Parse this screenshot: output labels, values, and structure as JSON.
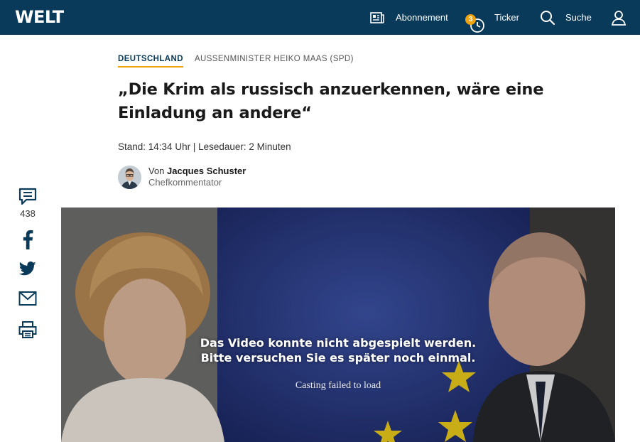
{
  "header": {
    "logo": "WELT",
    "nav": {
      "abonnement": "Abonnement",
      "ticker": "Ticker",
      "ticker_badge": "3",
      "suche": "Suche"
    }
  },
  "article": {
    "section": "DEUTSCHLAND",
    "topic": "AUSSENMINISTER HEIKO MAAS (SPD)",
    "headline_line1": "„Die Krim als russisch anzuerkennen, wäre eine",
    "headline_line2": "Einladung an andere“",
    "dateline": "Stand: 14:34 Uhr | Lesedauer: 2 Minuten",
    "author": {
      "prefix": "Von",
      "name": "Jacques Schuster",
      "role": "Chefkommentator"
    }
  },
  "share": {
    "comments_count": "438"
  },
  "video": {
    "error_line1": "Das Video konnte nicht abgespielt werden.",
    "error_line2": "Bitte versuchen Sie es später noch einmal.",
    "status": "Casting failed to load"
  },
  "colors": {
    "header_bg": "#0a3a5a",
    "accent": "#f0a30a",
    "icon_blue": "#0a3a5a"
  }
}
